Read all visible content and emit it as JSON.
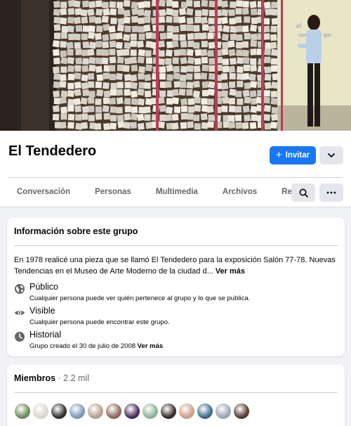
{
  "group": {
    "name": "El Tendedero",
    "invite_label": "Invitar"
  },
  "tabs": [
    {
      "label": "Conversación"
    },
    {
      "label": "Personas"
    },
    {
      "label": "Multimedia"
    },
    {
      "label": "Archivos"
    },
    {
      "label": "Reels"
    }
  ],
  "about": {
    "title": "Información sobre este grupo",
    "description": "En 1978 realicé una pieza que se llamó El Tendedero para la exposición Salón 77-78. Nuevas Tendencias en el Museo de Arte Moderno de la ciudad d...",
    "see_more": "Ver más",
    "privacy": {
      "title": "Público",
      "subtitle": "Cualquier persona puede ver quién pertenece al grupo y lo que se publica.",
      "icon": "globe-icon"
    },
    "visibility": {
      "title": "Visible",
      "subtitle": "Cualquier persona puede encontrar este grupo.",
      "icon": "eye-icon"
    },
    "history": {
      "title": "Historial",
      "subtitle": "Grupo creado el 30 de julio de 2008",
      "see_more": "Ver más",
      "icon": "clock-icon"
    }
  },
  "members": {
    "title": "Miembros",
    "separator": " · ",
    "count": "2.2 mil",
    "avatar_colors": [
      "#6b8e5a",
      "#d9d4cc",
      "#2f2f2f",
      "#7a9ab5",
      "#b5a08a",
      "#8c6a5a",
      "#4a2c5e",
      "#8fb39a",
      "#3a2a2a",
      "#c9a088",
      "#3b6e8f",
      "#9aa6b5",
      "#5a3a30"
    ]
  },
  "colors": {
    "accent": "#1877f2",
    "secondary_button": "#e4e6eb",
    "muted_text": "#65676b"
  }
}
